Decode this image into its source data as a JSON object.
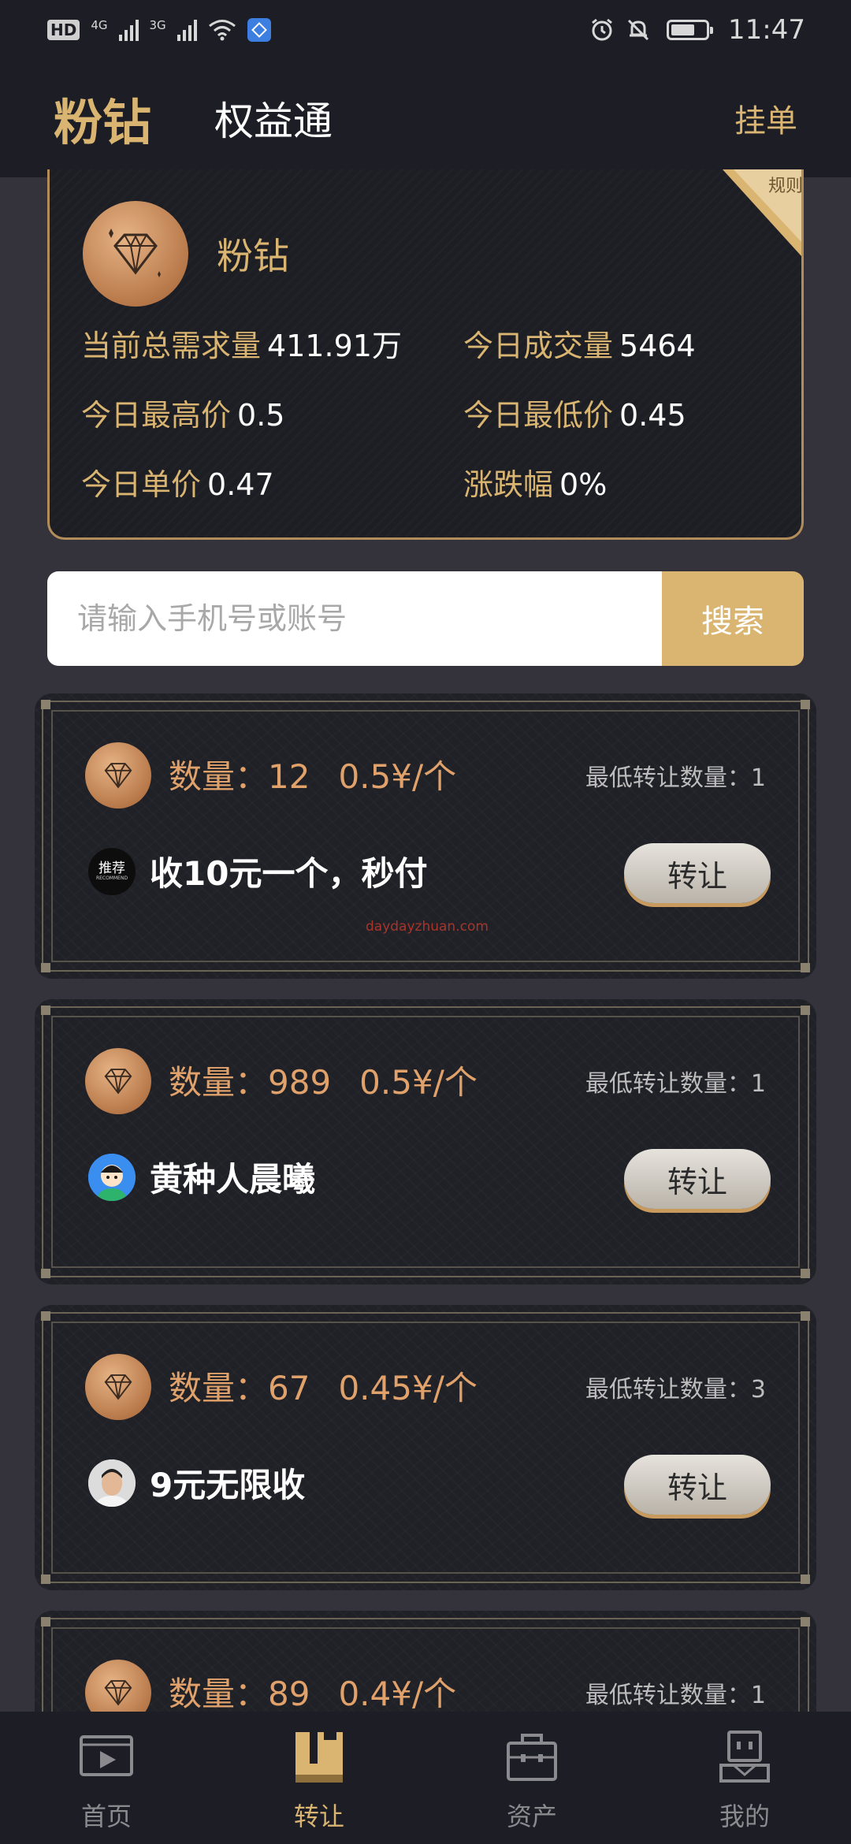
{
  "status_bar": {
    "hd": "HD",
    "sim1_network": "4G",
    "sim2_network": "3G",
    "time": "11:47",
    "icons": [
      "hd-icon",
      "signal-icon",
      "wifi-icon",
      "app-notification-icon",
      "alarm-icon",
      "mute-icon",
      "battery-icon"
    ]
  },
  "header": {
    "active_tab": "粉钻",
    "tab2": "权益通",
    "action": "挂单"
  },
  "summary": {
    "rules_label": "规则",
    "title": "粉钻",
    "stats": [
      {
        "label": "当前总需求量",
        "value": "411.91万"
      },
      {
        "label": "今日成交量",
        "value": "5464"
      },
      {
        "label": "今日最高价",
        "value": "0.5"
      },
      {
        "label": "今日最低价",
        "value": "0.45"
      },
      {
        "label": "今日单价",
        "value": "0.47"
      },
      {
        "label": "涨跌幅",
        "value": "0%"
      }
    ]
  },
  "search": {
    "placeholder": "请输入手机号或账号",
    "button": "搜索"
  },
  "listings": [
    {
      "quantity": "数量：12",
      "price": "0.5¥/个",
      "min_qty": "最低转让数量：1",
      "seller": "收10元一个，秒付",
      "avatar": "recommend",
      "avatar_text": "推荐",
      "avatar_sub": "RECOMMEND",
      "button": "转让",
      "watermark": "daydayzhuan.com"
    },
    {
      "quantity": "数量：989",
      "price": "0.5¥/个",
      "min_qty": "最低转让数量：1",
      "seller": "黄种人晨曦",
      "avatar": "cartoon",
      "button": "转让"
    },
    {
      "quantity": "数量：67",
      "price": "0.45¥/个",
      "min_qty": "最低转让数量：3",
      "seller": "9元无限收",
      "avatar": "photo",
      "button": "转让"
    },
    {
      "quantity": "数量：89",
      "price": "0.4¥/个",
      "min_qty": "最低转让数量：1"
    }
  ],
  "nav": [
    {
      "label": "首页",
      "icon": "home-video-icon",
      "active": false
    },
    {
      "label": "转让",
      "icon": "transfer-icon",
      "active": true
    },
    {
      "label": "资产",
      "icon": "assets-icon",
      "active": false
    },
    {
      "label": "我的",
      "icon": "profile-icon",
      "active": false
    }
  ],
  "colors": {
    "accent_gold": "#d9b571",
    "header_bg": "#1d1d25",
    "page_bg": "#34333b",
    "qty_orange": "#e0a26a"
  }
}
